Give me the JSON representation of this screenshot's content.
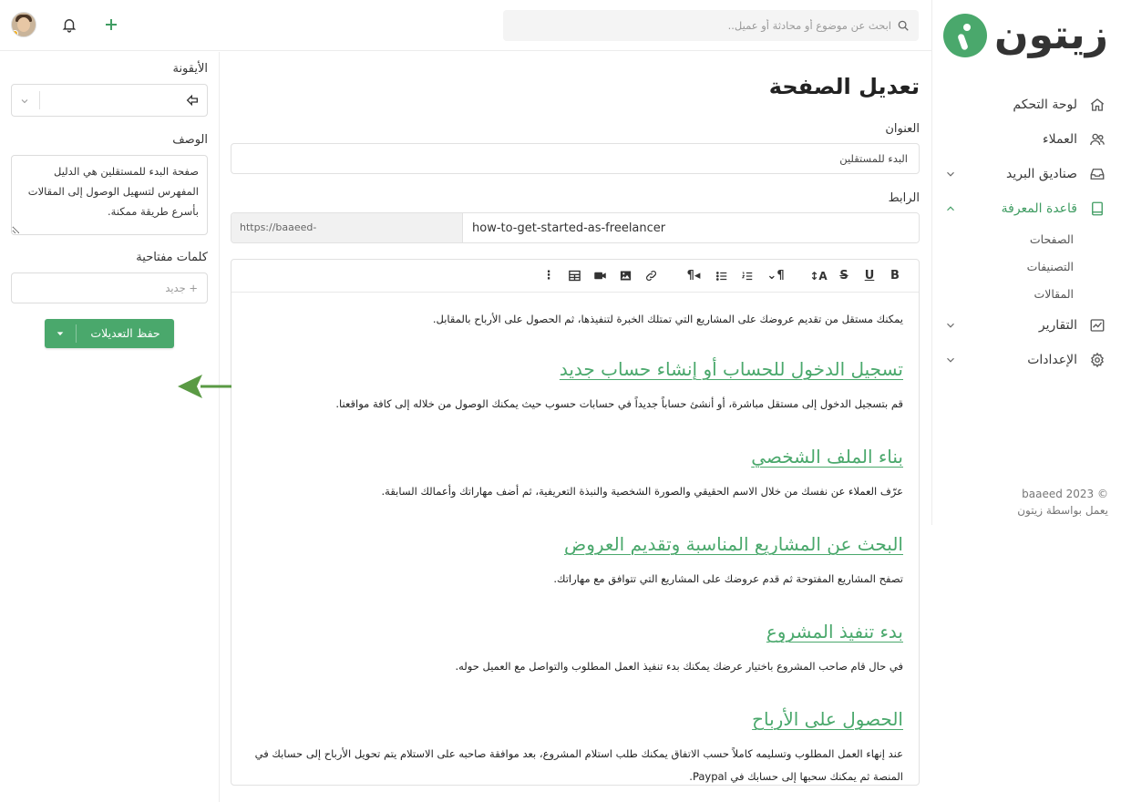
{
  "brand": {
    "logo_text": "زيتون",
    "accent_color": "#4aa86c"
  },
  "topbar": {
    "search_placeholder": "ابحث عن موضوع أو محادثة أو عميل..",
    "icons": [
      "search-icon",
      "plus-icon",
      "bell-icon",
      "user-avatar"
    ]
  },
  "sidebar": {
    "items": [
      {
        "label": "لوحة التحكم",
        "icon": "home-icon"
      },
      {
        "label": "العملاء",
        "icon": "users-icon"
      },
      {
        "label": "صناديق البريد",
        "icon": "inbox-icon",
        "expandable": true
      },
      {
        "label": "قاعدة المعرفة",
        "icon": "book-icon",
        "expandable": true,
        "active": true
      },
      {
        "label": "التقارير",
        "icon": "chart-icon",
        "expandable": true
      },
      {
        "label": "الإعدادات",
        "icon": "gear-icon",
        "expandable": true
      }
    ],
    "subitems": [
      {
        "label": "الصفحات"
      },
      {
        "label": "التصنيفات"
      },
      {
        "label": "المقالات"
      }
    ],
    "copyright": "baaeed 2023 ©",
    "powered_by": "يعمل بواسطة زيتون"
  },
  "main": {
    "page_title": "تعديل الصفحة",
    "title_label": "العنوان",
    "title_value": "البدء للمستقلين",
    "link_label": "الرابط",
    "url_prefix": "https://baaeed-dev.zaetoon.hsoubdev.com/page/",
    "url_slug": "how-to-get-started-as-freelancer"
  },
  "editor": {
    "toolbar": [
      "bold-icon",
      "underline-icon",
      "strikethrough-icon",
      "text-size-icon",
      "paragraph-icon",
      "ordered-list-icon",
      "bullet-list-icon",
      "paragraph-direction-icon",
      "link-icon",
      "image-icon",
      "video-icon",
      "table-icon",
      "more-icon"
    ],
    "intro": "يمكنك مستقل من تقديم عروضك على المشاريع التي تمتلك الخبرة لتنفيذها، ثم الحصول على الأرباح بالمقابل.",
    "sections": [
      {
        "heading": "تسجيل الدخول للحساب أو إنشاء حساب جديد",
        "body": "قم بتسجيل الدخول إلى مستقل مباشرة، أو أنشئ حساباً جديداً في حسابات حسوب حيث يمكنك الوصول من خلاله إلى كافة مواقعنا."
      },
      {
        "heading": "بناء الملف الشخصي",
        "body": "عرّف العملاء عن نفسك من خلال الاسم الحقيقي والصورة الشخصية والنبذة التعريفية، ثم أضف مهاراتك وأعمالك السابقة."
      },
      {
        "heading": "البحث عن المشاريع المناسبة وتقديم العروض",
        "body": "تصفح المشاريع المفتوحة ثم قدم عروضك على المشاريع التي تتوافق مع مهاراتك."
      },
      {
        "heading": "بدء تنفيذ المشروع",
        "body": "في حال قام صاحب المشروع باختيار عرضك يمكنك بدء تنفيذ العمل المطلوب والتواصل مع العميل حوله."
      },
      {
        "heading": "الحصول على الأرباح",
        "body": "عند إنهاء العمل المطلوب وتسليمه كاملاً حسب الاتفاق يمكنك طلب استلام المشروع، بعد موافقة صاحبه على الاستلام يتم تحويل الأرباح إلى حسابك في المنصة ثم يمكنك سحبها إلى حسابك في Paypal."
      }
    ]
  },
  "settings": {
    "icon_label": "الأيقونة",
    "selected_icon": "arrow-left-icon",
    "description_label": "الوصف",
    "description_value": "صفحة البدء للمستقلين هي الدليل المفهرس لتسهيل الوصول إلى المقالات بأسرع طريقة ممكنة.",
    "keywords_label": "كلمات مفتاحية",
    "keywords_placeholder": "+ جديد",
    "save_label": "حفظ التعديلات"
  }
}
